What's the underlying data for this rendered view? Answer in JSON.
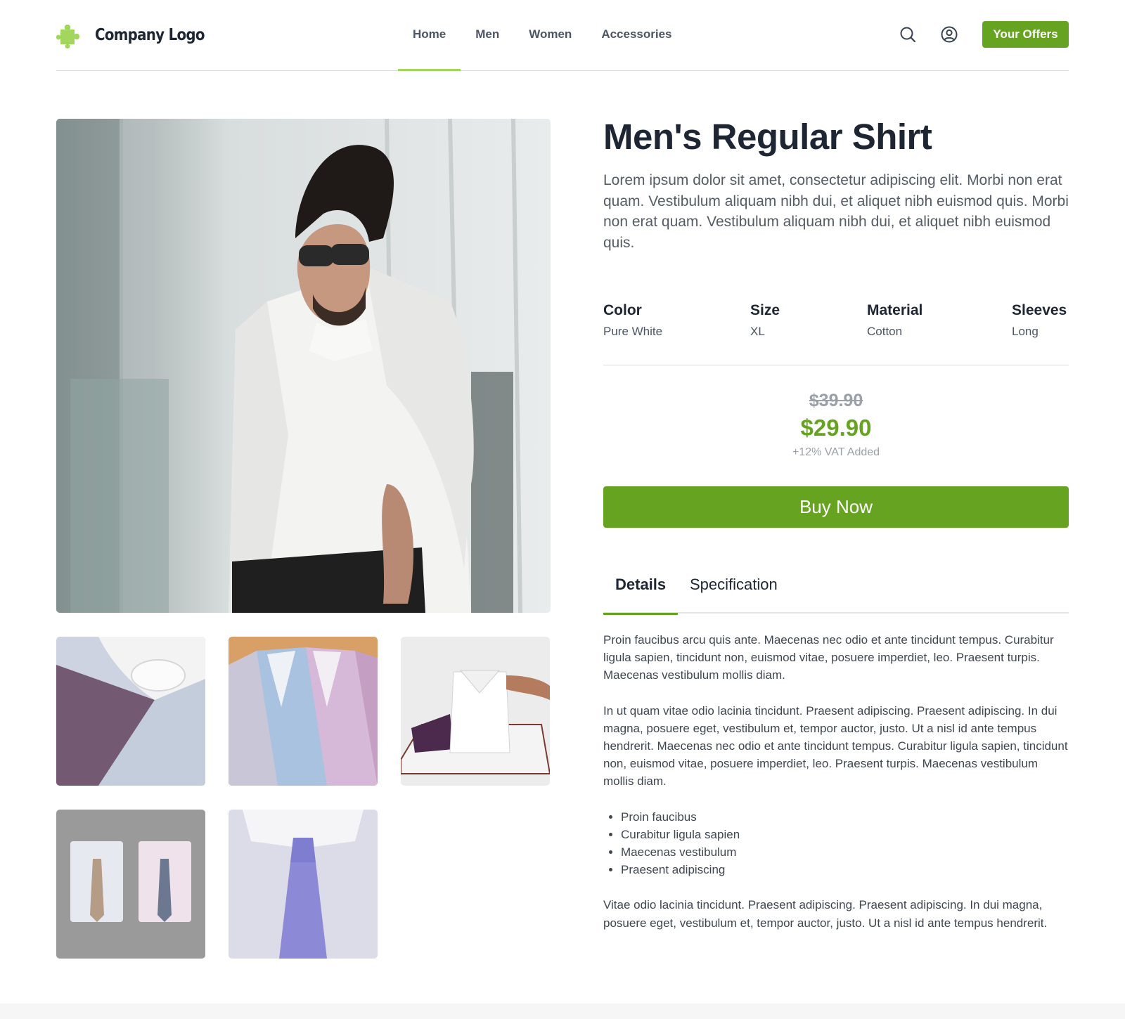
{
  "header": {
    "logo_text": "Company Logo",
    "logo_icon": "puzzle-piece-icon",
    "nav": [
      {
        "label": "Home",
        "active": true
      },
      {
        "label": "Men",
        "active": false
      },
      {
        "label": "Women",
        "active": false
      },
      {
        "label": "Accessories",
        "active": false
      }
    ],
    "search_icon": "search-icon",
    "account_icon": "user-circle-icon",
    "offers_label": "Your Offers"
  },
  "product": {
    "title": "Men's Regular Shirt",
    "description": "Lorem ipsum dolor sit amet, consectetur adipiscing elit. Morbi non erat quam. Vestibulum aliquam nibh dui, et aliquet nibh euismod quis. Morbi non erat quam. Vestibulum aliquam nibh dui, et aliquet nibh euismod quis.",
    "attributes": [
      {
        "label": "Color",
        "value": "Pure White"
      },
      {
        "label": "Size",
        "value": "XL"
      },
      {
        "label": "Material",
        "value": "Cotton"
      },
      {
        "label": "Sleeves",
        "value": "Long"
      }
    ],
    "old_price": "$39.90",
    "price": "$29.90",
    "vat_note": "+12% VAT Added",
    "buy_label": "Buy Now"
  },
  "gallery": {
    "images": [
      "main-model-photo",
      "folded-shirts-photo",
      "shirts-on-hangers-photo",
      "folded-white-shirt-photo",
      "two-shirts-with-ties-photo",
      "tie-closeup-photo"
    ]
  },
  "tabs": [
    {
      "label": "Details",
      "active": true
    },
    {
      "label": "Specification",
      "active": false
    }
  ],
  "details": {
    "paragraph_1": "Proin faucibus arcu quis ante. Maecenas nec odio et ante tincidunt tempus. Curabitur ligula sapien, tincidunt non, euismod vitae, posuere imperdiet, leo. Praesent turpis. Maecenas vestibulum mollis diam.",
    "paragraph_2": "In ut quam vitae odio lacinia tincidunt. Praesent adipiscing. Praesent adipiscing. In dui magna, posuere eget, vestibulum et, tempor auctor, justo. Ut a nisl id ante tempus hendrerit. Maecenas nec odio et ante tincidunt tempus. Curabitur ligula sapien, tincidunt non, euismod vitae, posuere imperdiet, leo. Praesent turpis. Maecenas vestibulum mollis diam.",
    "bullets": [
      "Proin faucibus",
      "Curabitur ligula sapien",
      "Maecenas vestibulum",
      "Praesent adipiscing"
    ],
    "paragraph_3": "Vitae odio lacinia tincidunt. Praesent adipiscing. Praesent adipiscing. In dui magna, posuere eget, vestibulum et, tempor auctor, justo. Ut a nisl id ante tempus hendrerit."
  },
  "colors": {
    "accent": "#65a320",
    "nav_underline": "#a3d65c",
    "heading": "#1e2633",
    "muted": "#9aa0a8"
  }
}
